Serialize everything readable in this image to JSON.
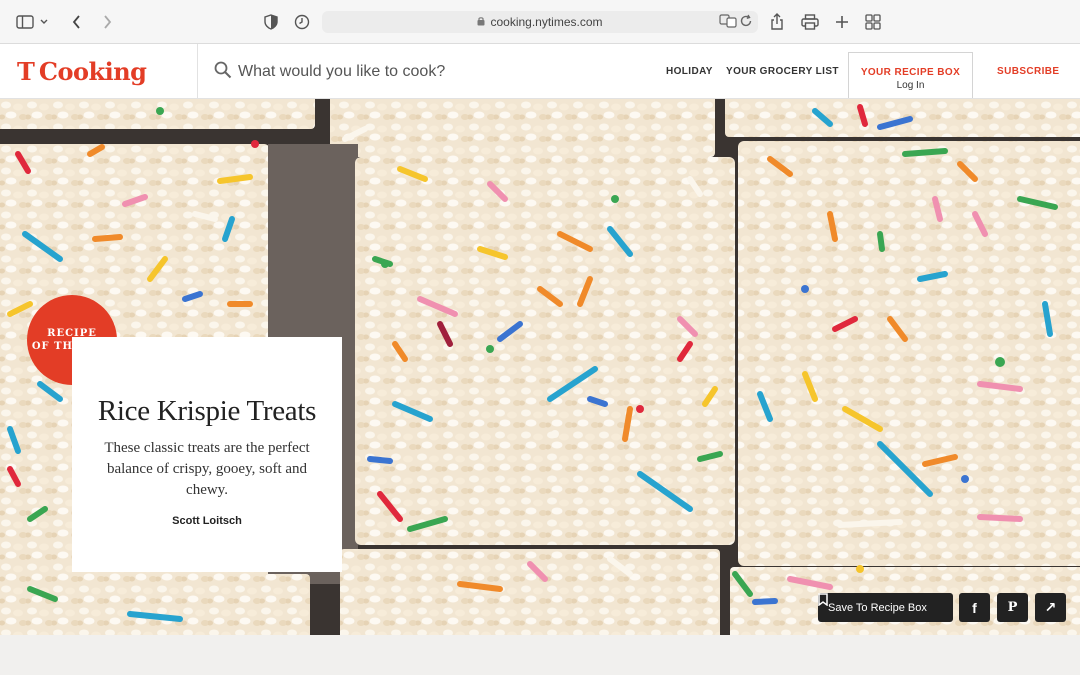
{
  "browser": {
    "url": "cooking.nytimes.com",
    "icons": [
      "sidebar-icon",
      "chevron-down-icon",
      "back-icon",
      "forward-icon",
      "shield-icon",
      "history-icon",
      "lock-icon",
      "translate-icon",
      "reload-icon",
      "share-icon",
      "print-icon",
      "new-tab-icon",
      "tab-overview-icon"
    ]
  },
  "header": {
    "logo_t": "T",
    "logo_text": "Cooking",
    "search_placeholder": "What would you like to cook?",
    "nav": [
      "HOLIDAY",
      "YOUR GROCERY LIST"
    ],
    "recipe_box": "YOUR RECIPE BOX",
    "login": "Log In",
    "subscribe": "SUBSCRIBE"
  },
  "hero": {
    "badge_line1": "RECIPE",
    "badge_line2": "OF THE DAY",
    "title": "Rice Krispie Treats",
    "description": "These classic treats are the perfect balance of crispy, gooey, soft and chewy.",
    "author": "Scott Loitsch",
    "save_label": "Save To Recipe Box",
    "facebook": "f",
    "pinterest": "P",
    "share": "↗"
  },
  "colors": {
    "brand_red": "#e33d26",
    "button_dark": "#222222"
  }
}
